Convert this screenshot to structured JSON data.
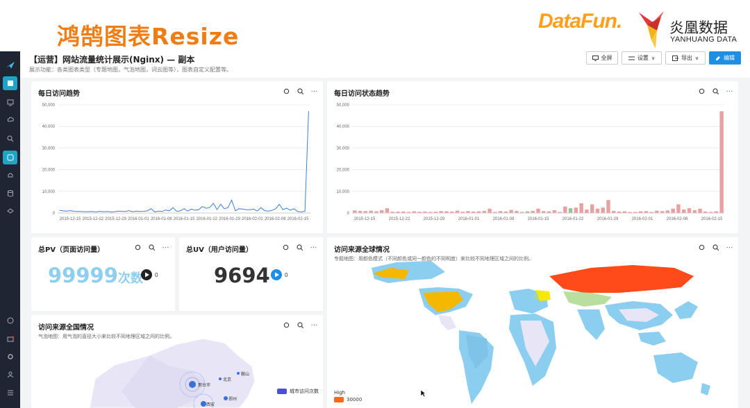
{
  "banner": {
    "title": "鸿鹄图表Resize",
    "logo_datafun": "DataFun.",
    "logo_yanhuang_cn": "炎凰数据",
    "logo_yanhuang_en": "YANHUANG DATA"
  },
  "sidebar": {
    "icons": [
      "logo-icon",
      "dashboard-icon",
      "monitor-icon",
      "upload-icon",
      "search-icon",
      "panel-icon",
      "bell-icon",
      "database-icon",
      "layers-icon",
      "help-icon",
      "message-icon",
      "settings-icon",
      "user-icon",
      "menu-icon"
    ]
  },
  "header": {
    "title": "【运营】网站流量统计展示(Nginx) — 副本",
    "subtitle": "展示功能：各类图表类型（专题地图，气泡地图，词云图等），图表自定义配置等。",
    "buttons": {
      "fullscreen": "全屏",
      "settings": "设置",
      "export": "导出",
      "edit": "编辑"
    }
  },
  "cards": {
    "daily_trend": {
      "title": "每日访问趋势"
    },
    "status_trend": {
      "title": "每日访问状态趋势"
    },
    "pv": {
      "title": "总PV（页面访问量）",
      "value": "99999",
      "unit": "次数",
      "change": "0"
    },
    "uv": {
      "title": "总UV（用户访问量）",
      "value": "9694",
      "change": "0"
    },
    "world": {
      "title": "访问来源全球情况",
      "desc": "专题地图：用颜色模式（不同颜色或同一颜色的不同明度）来比较不同地理区域之间的比例。",
      "legend_label": "High",
      "legend_value": "30000"
    },
    "china": {
      "title": "访问来源全国情况",
      "desc": "气泡地图：用气泡的直径大小来比较不同地理区域之间的比例。",
      "legend_label": "城市访问次数",
      "cities": [
        "北京",
        "鞍山",
        "邢台市",
        "郑州",
        "西安"
      ]
    }
  },
  "colors": {
    "accent": "#1f8fe5",
    "line": "#3a7fd5",
    "bar": "#e9a0a0",
    "pv_number": "#8ecff0"
  },
  "chart_data": [
    {
      "type": "line",
      "title": "每日访问趋势",
      "y_ticks": [
        "50,000",
        "40,000",
        "30,000",
        "20,000",
        "10,000",
        "0"
      ],
      "ylim": [
        0,
        50000
      ],
      "x_ticks": [
        "2015-12-15",
        "2015-12-22",
        "2015-12-29",
        "2016-01-01",
        "2016-01-08",
        "2016-01-15",
        "2016-01-22",
        "2016-01-29",
        "2016-02-01",
        "2016-02-08",
        "2016-02-15"
      ],
      "values": [
        1200,
        1000,
        900,
        1100,
        800,
        700,
        750,
        600,
        650,
        700,
        500,
        800,
        600,
        700,
        500,
        600,
        900,
        800,
        700,
        1100,
        600,
        900,
        700,
        800,
        1000,
        2000,
        500,
        900,
        700,
        1400,
        1000,
        2500,
        800,
        1000,
        2000,
        900,
        1800,
        1300,
        1500,
        3000,
        2200,
        2500,
        4500,
        1600,
        4000,
        2000,
        2500,
        6000,
        1000,
        2000,
        1800,
        1500,
        1500,
        1800,
        900,
        2500,
        1100,
        900,
        1200,
        2000,
        4000,
        1600,
        2200,
        1300,
        2000,
        700,
        500,
        800,
        47000
      ],
      "grid": true
    },
    {
      "type": "bar",
      "title": "每日访问状态趋势",
      "y_ticks": [
        "50,000",
        "40,000",
        "30,000",
        "20,000",
        "10,000",
        "0"
      ],
      "ylim": [
        0,
        50000
      ],
      "x_ticks": [
        "2015-12-15",
        "2015-12-22",
        "2015-12-29",
        "2016-01-01",
        "2016-01-08",
        "2016-01-15",
        "2016-01-22",
        "2016-01-29",
        "2016-02-01",
        "2016-02-08",
        "2016-02-15"
      ],
      "values": [
        1200,
        1000,
        900,
        1100,
        800,
        1300,
        2200,
        600,
        650,
        700,
        500,
        800,
        600,
        700,
        500,
        600,
        900,
        800,
        700,
        1100,
        600,
        900,
        700,
        800,
        1000,
        2000,
        500,
        900,
        700,
        1400,
        1000,
        500,
        800,
        1000,
        2000,
        900,
        800,
        1300,
        500,
        3000,
        2200,
        2500,
        4500,
        1600,
        4000,
        2000,
        2500,
        6000,
        1000,
        700,
        800,
        500,
        500,
        800,
        900,
        500,
        1100,
        900,
        1200,
        2000,
        4000,
        1600,
        2200,
        1300,
        2000,
        700,
        500,
        800,
        47000
      ],
      "grid": true
    }
  ]
}
